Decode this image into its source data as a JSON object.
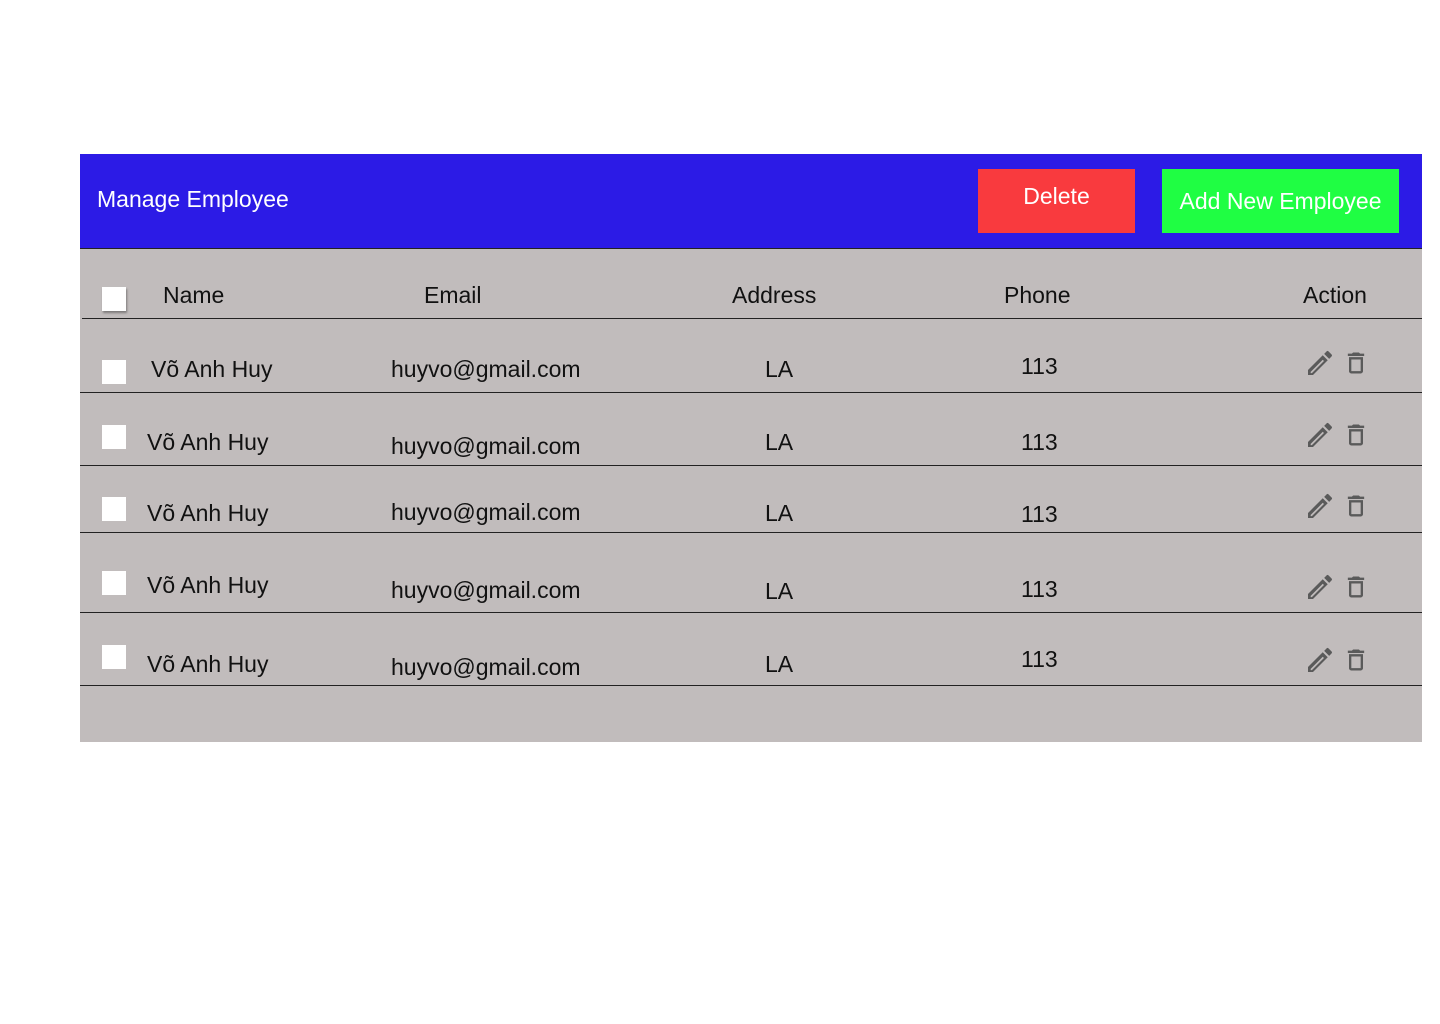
{
  "header": {
    "title": "Manage Employee",
    "delete_label": "Delete",
    "add_label": "Add New Employee"
  },
  "table": {
    "columns": [
      "Name",
      "Email",
      "Address",
      "Phone",
      "Action"
    ],
    "rows": [
      {
        "name": "Võ Anh Huy",
        "email": "huyvo@gmail.com",
        "address": "LA",
        "phone": "113"
      },
      {
        "name": "Võ Anh Huy",
        "email": "huyvo@gmail.com",
        "address": "LA",
        "phone": "113"
      },
      {
        "name": "Võ Anh Huy",
        "email": "huyvo@gmail.com",
        "address": "LA",
        "phone": "113"
      },
      {
        "name": "Võ Anh Huy",
        "email": "huyvo@gmail.com",
        "address": "LA",
        "phone": "113"
      },
      {
        "name": "Võ Anh Huy",
        "email": "huyvo@gmail.com",
        "address": "LA",
        "phone": "113"
      }
    ],
    "action_icons": [
      "pencil-icon",
      "trash-icon"
    ]
  },
  "colors": {
    "header_bg": "#2c1be6",
    "delete_bg": "#f93a3e",
    "add_bg": "#1ffe43",
    "table_bg": "#c1bcbc",
    "icon_color": "#5a5a5a"
  }
}
